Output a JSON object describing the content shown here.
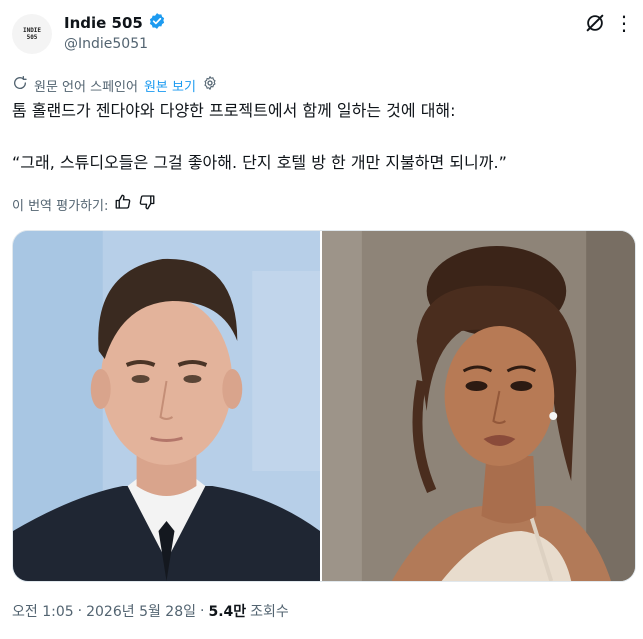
{
  "author": {
    "avatar_text_line1": "INDIE",
    "avatar_text_line2": "505",
    "display_name": "Indie 505",
    "handle": "@Indie5051",
    "verified_color": "#1d9bf0"
  },
  "translation": {
    "label": "원문 언어 스페인어",
    "show_original": "원본 보기"
  },
  "tweet": {
    "line1": "톰 홀랜드가 젠다야와 다양한 프로젝트에서 함께 일하는 것에 대해:",
    "line2": "“그래, 스튜디오들은 그걸 좋아해. 단지 호텔 방 한 개만 지불하면 되니까.”"
  },
  "rating": {
    "label": "이 번역 평가하기:"
  },
  "meta": {
    "time": "오전 1:05",
    "separator": "·",
    "date": "2026년 5월 28일",
    "views_count": "5.4만",
    "views_label": "조회수"
  },
  "colors": {
    "accent": "#1d9bf0",
    "secondary_text": "#536471"
  }
}
